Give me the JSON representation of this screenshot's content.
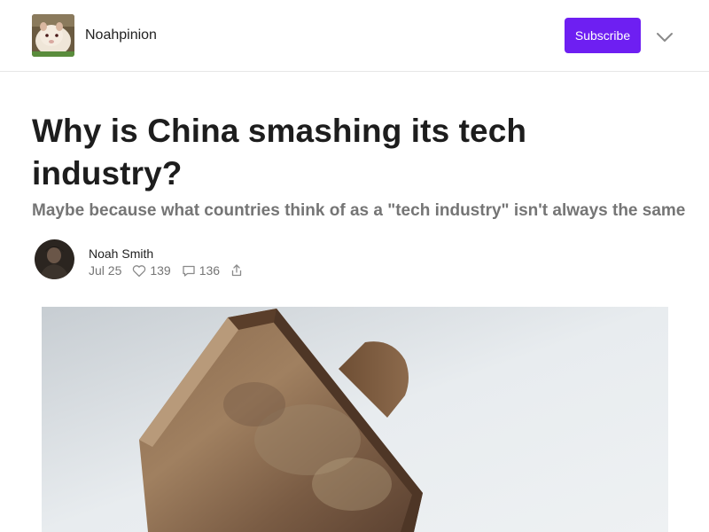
{
  "header": {
    "site_name": "Noahpinion",
    "logo_icon": "guinea-pig-logo",
    "subscribe_label": "Subscribe",
    "menu_icon": "chevron-down-icon",
    "accent_color": "#6e1ff2"
  },
  "post": {
    "title": "Why is China smashing its tech industry?",
    "subtitle": "Maybe because what countries think of as a \"tech industry\" isn't always the same",
    "author": "Noah Smith",
    "date": "Jul 25",
    "likes": "139",
    "comments": "136",
    "hero_image": "hammer-photo"
  }
}
